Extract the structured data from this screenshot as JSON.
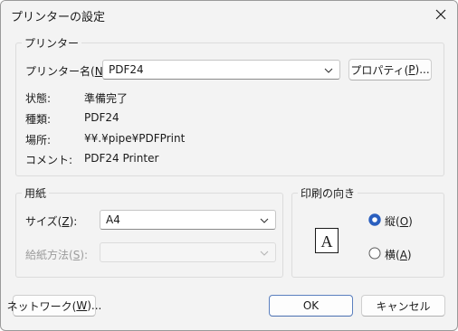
{
  "dialog": {
    "title": "プリンターの設定",
    "close_icon": "close-icon"
  },
  "printer": {
    "group_label": "プリンター",
    "name_label": "プリンター名(",
    "name_key": "N",
    "name_close": "):",
    "name_value": "PDF24",
    "properties_label": "プロパティ(",
    "properties_key": "P",
    "properties_close": ")...",
    "status_label": "状態:",
    "status_value": "準備完了",
    "type_label": "種類:",
    "type_value": "PDF24",
    "where_label": "場所:",
    "where_value": "¥¥.¥pipe¥PDFPrint",
    "comment_label": "コメント:",
    "comment_value": "PDF24 Printer"
  },
  "paper": {
    "group_label": "用紙",
    "size_label": "サイズ(",
    "size_key": "Z",
    "size_close": "):",
    "size_value": "A4",
    "source_label": "給紙方法(",
    "source_key": "S",
    "source_close": "):",
    "source_value": ""
  },
  "orientation": {
    "group_label": "印刷の向き",
    "portrait_label": "縦(",
    "portrait_key": "O",
    "portrait_close": ")",
    "landscape_label": "横(",
    "landscape_key": "A",
    "landscape_close": ")",
    "selected": "portrait",
    "preview_letter": "A"
  },
  "footer": {
    "network_label": "ネットワーク(",
    "network_key": "W",
    "network_close": ")...",
    "ok_label": "OK",
    "cancel_label": "キャンセル"
  },
  "colors": {
    "accent": "#2a5fbf",
    "dialog_bg": "#f3f3f3"
  }
}
